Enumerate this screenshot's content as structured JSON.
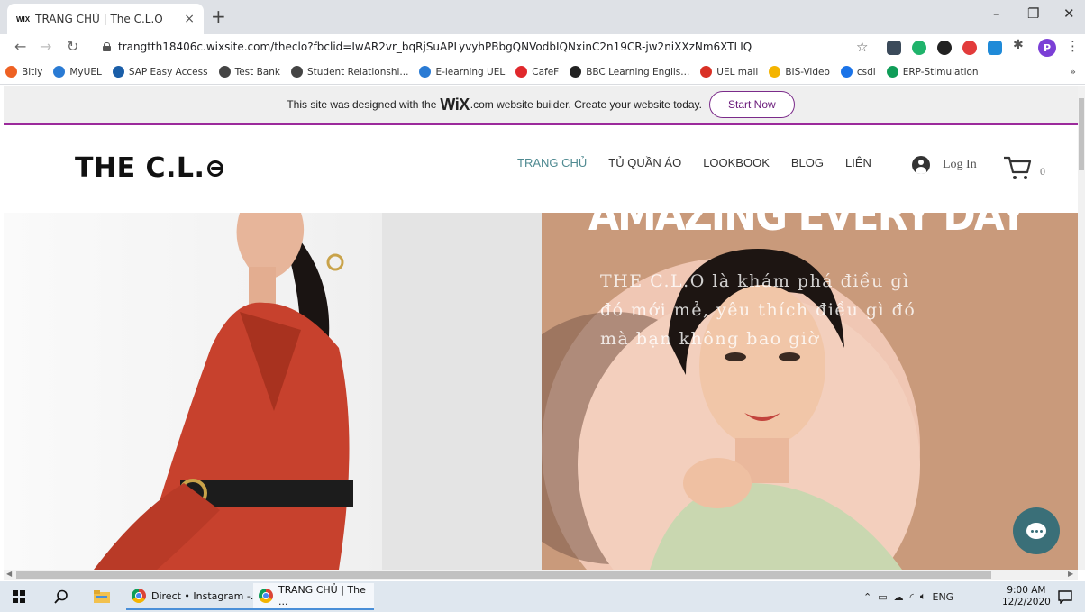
{
  "browser": {
    "tab": {
      "favicon_text": "WIX",
      "title": "TRANG CHỦ | The C.L.O",
      "close": "×"
    },
    "new_tab": "+",
    "window_controls": {
      "minimize": "–",
      "restore": "❐",
      "close": "✕"
    },
    "url": "trangtth18406c.wixsite.com/theclo?fbclid=IwAR2vr_bqRjSuAPLyvyhPBbgQNVodbIQNxinC2n19CR-jw2niXXzNm6XTLIQ",
    "profile_initial": "P",
    "bookmarks": [
      {
        "label": "Bitly",
        "color": "#ee6123"
      },
      {
        "label": "MyUEL",
        "color": "#2a7bd4"
      },
      {
        "label": "SAP Easy Access",
        "color": "#1a5ea8"
      },
      {
        "label": "Test Bank",
        "color": "#444444"
      },
      {
        "label": "Student Relationshi...",
        "color": "#444444"
      },
      {
        "label": "E-learning UEL",
        "color": "#2a7bd4"
      },
      {
        "label": "CafeF",
        "color": "#e0282c"
      },
      {
        "label": "BBC Learning Englis...",
        "color": "#222222"
      },
      {
        "label": "UEL mail",
        "color": "#d93025"
      },
      {
        "label": "BIS-Video",
        "color": "#f4b400"
      },
      {
        "label": "csdl",
        "color": "#1a73e8"
      },
      {
        "label": "ERP-Stimulation",
        "color": "#0f9d58"
      }
    ],
    "bookmarks_more": "»"
  },
  "wix_banner": {
    "text_before": "This site was designed with the",
    "logo": "WiX",
    "text_after": ".com website builder. Create your website today.",
    "button": "Start Now"
  },
  "site": {
    "logo": "THE C.L.",
    "nav": [
      {
        "label": "TRANG CHỦ",
        "active": true
      },
      {
        "label": "TỦ QUẦN ÁO",
        "active": false
      },
      {
        "label": "LOOKBOOK",
        "active": false
      },
      {
        "label": "BLOG",
        "active": false
      },
      {
        "label": "LIÊN",
        "active": false
      }
    ],
    "login": "Log In",
    "cart_count": "0"
  },
  "hero": {
    "headline": "AMAZING EVERY DAY",
    "text": "THE C.L.O là khám phá điều gì đó mới mẻ, yêu thích điều gì đó mà bạn không bao giờ"
  },
  "taskbar": {
    "apps": [
      "Direct • Instagram -...",
      "TRANG CHỦ | The ..."
    ],
    "language": "ENG",
    "time": "9:00 AM",
    "date": "12/2/2020"
  }
}
